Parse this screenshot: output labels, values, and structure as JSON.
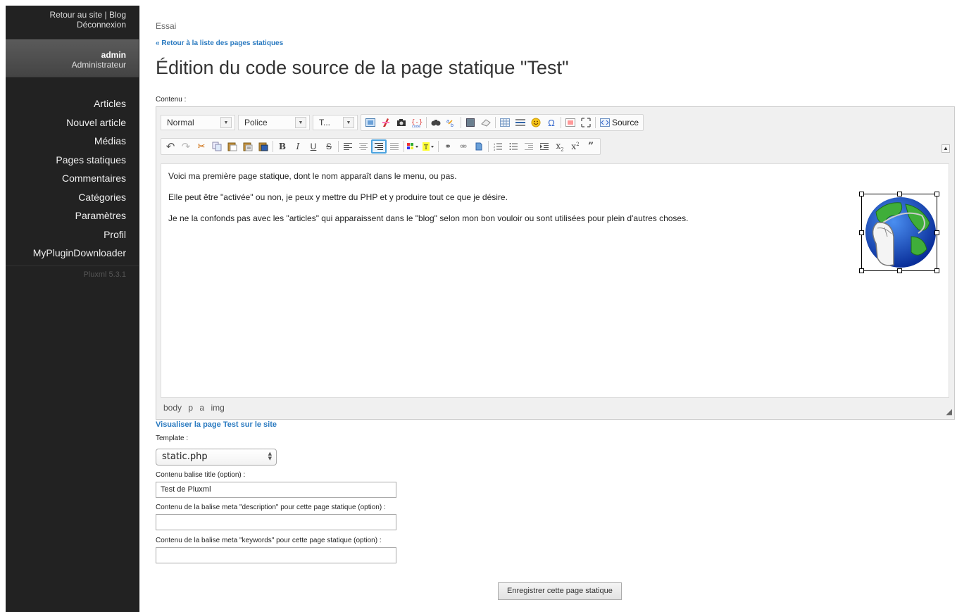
{
  "sidebar": {
    "top_links": {
      "site": "Retour au site",
      "separator": "|",
      "blog": "Blog",
      "logout": "Déconnexion"
    },
    "user": {
      "name": "admin",
      "role": "Administrateur"
    },
    "nav": [
      "Articles",
      "Nouvel article",
      "Médias",
      "Pages statiques",
      "Commentaires",
      "Catégories",
      "Paramètres",
      "Profil",
      "MyPluginDownloader"
    ],
    "version": "Pluxml 5.3.1"
  },
  "main": {
    "site_name": "Essai",
    "back_link": "« Retour à la liste des pages statiques",
    "title": "Édition du code source de la page statique \"Test\"",
    "content_label": "Contenu :",
    "view_link": "Visualiser la page Test sur le site",
    "template_label": "Template :",
    "template_value": "static.php",
    "title_tag_label": "Contenu balise title (option) :",
    "title_tag_value": "Test de Pluxml",
    "meta_desc_label": "Contenu de la balise meta \"description\" pour cette page statique (option) :",
    "meta_desc_value": "",
    "meta_kw_label": "Contenu de la balise meta \"keywords\" pour cette page statique (option) :",
    "meta_kw_value": "",
    "save_button": "Enregistrer cette page statique"
  },
  "editor": {
    "format_combo": "Normal",
    "font_combo": "Police",
    "size_combo": "T...",
    "source_button": "Source",
    "paragraphs": [
      "Voici ma première page statique, dont le nom apparaît dans le menu, ou pas.",
      "Elle peut être \"activée\" ou non, je peux y mettre du PHP et y produire tout ce que je désire.",
      "Je ne la confonds pas avec les \"articles\" qui apparaissent dans le \"blog\" selon mon bon vouloir ou sont utilisées pour plein d'autres choses."
    ],
    "path": [
      "body",
      "p",
      "a",
      "img"
    ]
  },
  "colors": {
    "sidebar_bg": "#222222",
    "link": "#2a7ac0",
    "active_button_border": "#4aa3df"
  }
}
